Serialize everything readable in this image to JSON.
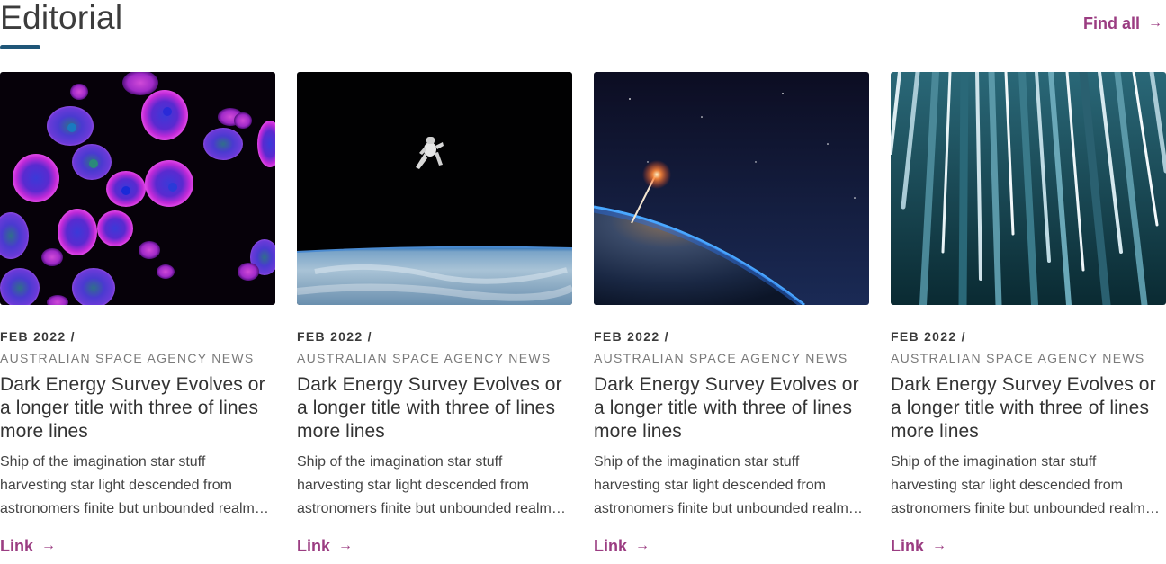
{
  "section": {
    "title": "Editorial",
    "find_all_label": "Find all",
    "arrow_icon": "→",
    "accent_color": "#9b3d82",
    "underline_color": "#1f5678"
  },
  "cards": [
    {
      "image": "cells-microscopy-image",
      "date": "FEB 2022 /",
      "source": "AUSTRALIAN SPACE AGENCY NEWS",
      "title": "Dark Energy Survey Evolves or a longer title with three of lines more lines",
      "excerpt": "Ship of the imagination star stuff harvesting star light descended from astronomers finite but unbounded realm of the galaxies",
      "link_label": "Link"
    },
    {
      "image": "astronaut-above-earth-image",
      "date": "FEB 2022 /",
      "source": "AUSTRALIAN SPACE AGENCY NEWS",
      "title": "Dark Energy Survey Evolves or a longer title with three of lines more lines",
      "excerpt": "Ship of the imagination star stuff harvesting star light descended from astronomers finite but unbounded realm of the galaxies",
      "link_label": "Link"
    },
    {
      "image": "earth-horizon-launch-image",
      "date": "FEB 2022 /",
      "source": "AUSTRALIAN SPACE AGENCY NEWS",
      "title": "Dark Energy Survey Evolves or a longer title with three of lines more lines",
      "excerpt": "Ship of the imagination star stuff harvesting star light descended from astronomers finite but unbounded realm of the galaxies",
      "link_label": "Link"
    },
    {
      "image": "light-streaks-image",
      "date": "FEB 2022 /",
      "source": "AUSTRALIAN SPACE AGENCY NEWS",
      "title": "Dark Energy Survey Evolves or a longer title with three of lines more lines",
      "excerpt": "Ship of the imagination star stuff harvesting star light descended from astronomers finite but unbounded realm of the galaxies",
      "link_label": "Link"
    }
  ]
}
